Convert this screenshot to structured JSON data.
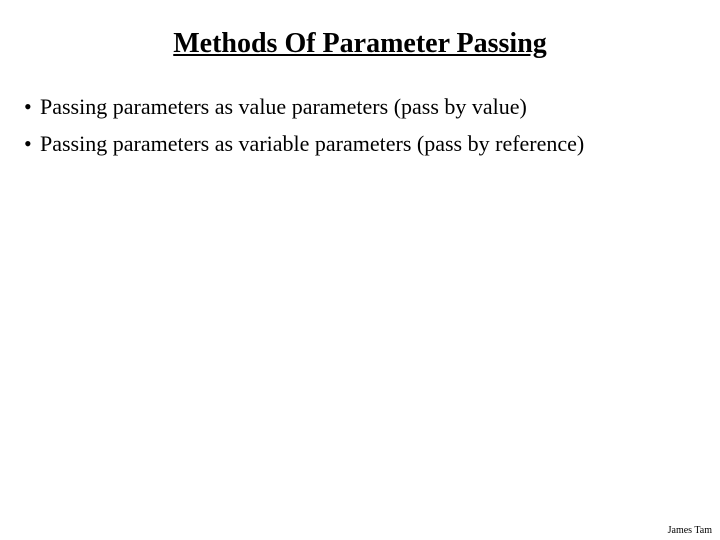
{
  "title": "Methods Of Parameter Passing",
  "bullets": {
    "item0": "Passing parameters as value parameters (pass by value)",
    "item1": "Passing parameters as variable parameters (pass by reference)"
  },
  "footer": "James Tam"
}
